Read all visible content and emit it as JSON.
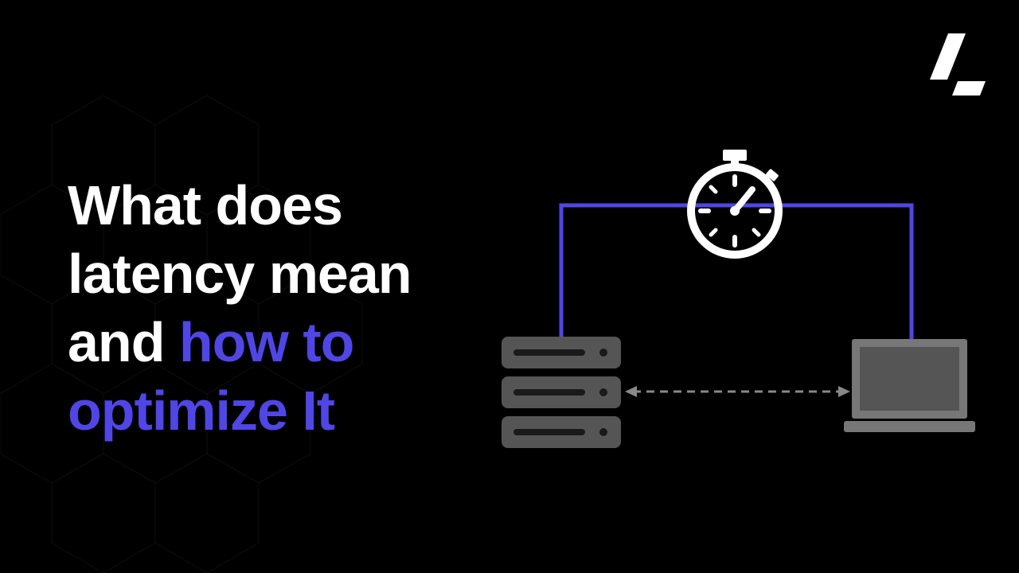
{
  "heading": {
    "line1": "What does",
    "line2": "latency mean",
    "line3_white": "and ",
    "line3_accent": "how to",
    "line4_accent": "optimize It"
  },
  "colors": {
    "accent": "#5046e5",
    "white": "#ffffff",
    "gray": "#555555",
    "darkgray": "#333333",
    "lightgray": "#777777"
  },
  "diagram": {
    "left_node": "server",
    "right_node": "laptop",
    "top_node": "stopwatch",
    "connection": "bidirectional-dashed"
  }
}
